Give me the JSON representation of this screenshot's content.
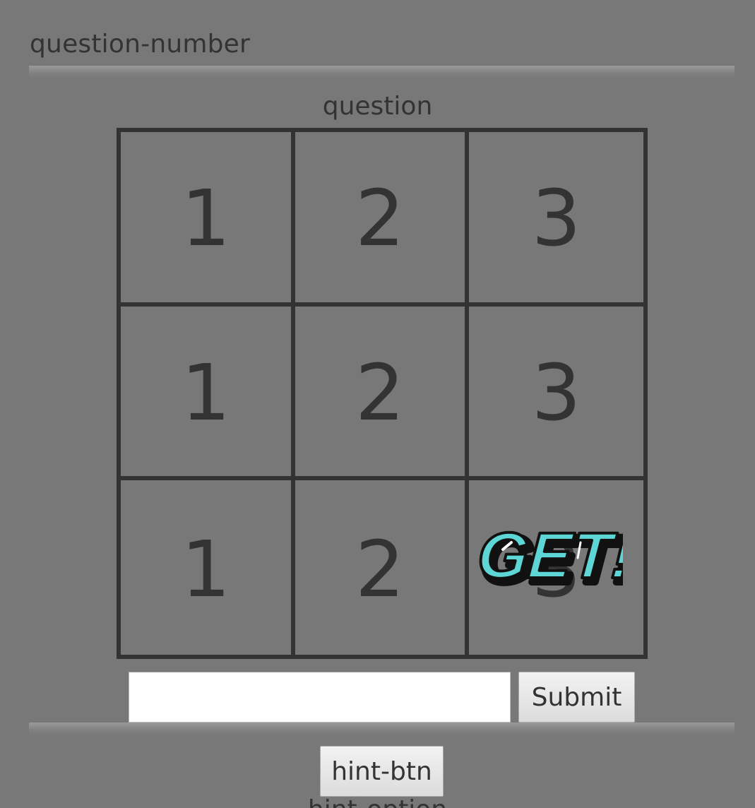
{
  "header": {
    "question_number": "question-number"
  },
  "main": {
    "question": "question",
    "grid": [
      [
        "1",
        "2",
        "3"
      ],
      [
        "1",
        "2",
        "3"
      ],
      [
        "1",
        "2",
        "3"
      ]
    ],
    "sticker": {
      "text": "GET!",
      "color": "#5fd6d6"
    }
  },
  "answer_form": {
    "input_value": "",
    "submit_label": "Submit"
  },
  "hint": {
    "button_label": "hint-btn",
    "option_text": "hint-option"
  }
}
